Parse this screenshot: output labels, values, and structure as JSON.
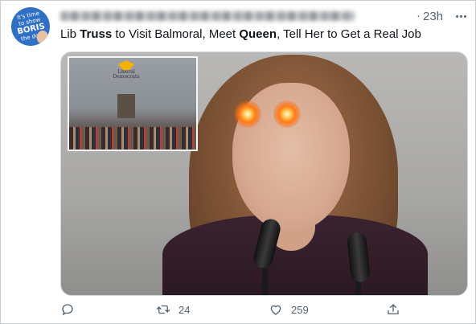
{
  "tweet": {
    "time": "23h",
    "dot": "·",
    "text_parts": [
      "Lib ",
      "Truss",
      " to Visit Balmoral, Meet ",
      "Queen",
      ", Tell Her to Get a Real Job"
    ],
    "avatar_text": {
      "line1": "it's time",
      "line2": "to show",
      "line3": "BORIS",
      "line4": "the door"
    }
  },
  "media": {
    "inset_logo_text": "Liberal Democrats"
  },
  "actions": {
    "replies": "",
    "retweets": "24",
    "likes": "259"
  },
  "colors": {
    "text_primary": "#0f1419",
    "text_secondary": "#536471",
    "border": "#cfd9de",
    "eye_glow": "#ff7a14"
  },
  "icons": [
    "more-icon",
    "reply-icon",
    "retweet-icon",
    "like-icon",
    "share-icon"
  ]
}
